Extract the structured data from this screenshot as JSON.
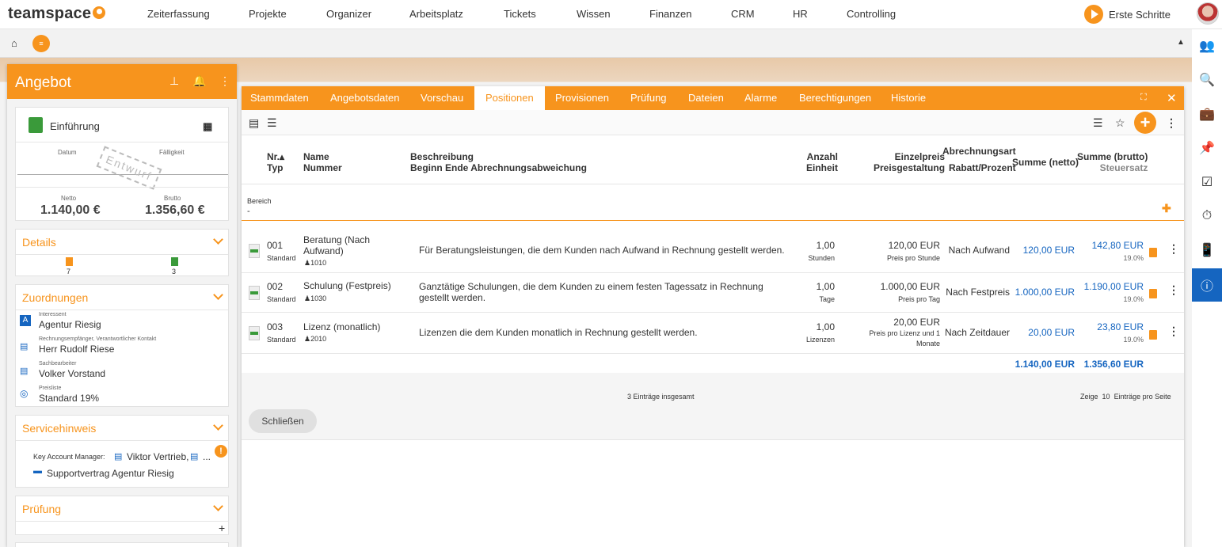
{
  "app": {
    "logo": "teamspace",
    "nav": [
      "Zeiterfassung",
      "Projekte",
      "Organizer",
      "Arbeitsplatz",
      "Tickets",
      "Wissen",
      "Finanzen",
      "CRM",
      "HR",
      "Controlling"
    ],
    "erste_schritte": "Erste Schritte"
  },
  "left": {
    "title": "Angebot",
    "einfuehrung": "Einführung",
    "datum_label": "Datum",
    "faelligkeit_label": "Fälligkeit",
    "stamp": "Entwurf",
    "netto_label": "Netto",
    "netto": "1.140,00 €",
    "brutto_label": "Brutto",
    "brutto": "1.356,60 €",
    "details": {
      "title": "Details",
      "count_a": "7",
      "count_b": "3"
    },
    "zuordnungen": {
      "title": "Zuordnungen",
      "items": [
        {
          "label": "Interessent",
          "value": "Agentur Riesig"
        },
        {
          "label": "Rechnungsempfänger, Verantwortlicher Kontakt",
          "value": "Herr Rudolf Riese"
        },
        {
          "label": "Sachbearbeiter",
          "value": "Volker Vorstand"
        },
        {
          "label": "Preisliste",
          "value": "Standard 19%"
        }
      ]
    },
    "servicehinweis": {
      "title": "Servicehinweis",
      "kam_label": "Key Account Manager:",
      "kam_value": "Viktor Vertrieb,",
      "kam_more": "...",
      "vertrag": "Supportvertrag Agentur Riesig"
    },
    "pruefung": {
      "title": "Prüfung"
    }
  },
  "dialog": {
    "tabs": [
      "Stammdaten",
      "Angebotsdaten",
      "Vorschau",
      "Positionen",
      "Provisionen",
      "Prüfung",
      "Dateien",
      "Alarme",
      "Berechtigungen",
      "Historie"
    ],
    "active_tab": "Positionen",
    "headers": {
      "nr": "Nr.▴",
      "typ": "Typ",
      "name": "Name",
      "nummer": "Nummer",
      "beschreibung": "Beschreibung",
      "beginn": "Beginn Ende Abrechnungsabweichung",
      "anzahl": "Anzahl",
      "einheit": "Einheit",
      "einzelpreis": "Einzelpreis",
      "preisgestaltung": "Preisgestaltung",
      "abrechnungsart": "Abrechnungsart",
      "rabatt": "Rabatt/Prozent",
      "summe_netto": "Summe (netto)",
      "summe_brutto": "Summe (brutto)",
      "steuersatz": "Steuersatz"
    },
    "bereich_label": "Bereich",
    "bereich_value": "-",
    "rows": [
      {
        "nr": "001",
        "typ": "Standard",
        "name": "Beratung (Nach Aufwand)",
        "nummer": "1010",
        "beschreibung": "Für Beratungsleistungen, die dem Kunden nach Aufwand in Rechnung gestellt werden.",
        "anzahl": "1,00",
        "einheit": "Stunden",
        "einzelpreis": "120,00 EUR",
        "preisgestaltung": "Preis pro Stunde",
        "abrechnungsart": "Nach Aufwand",
        "netto": "120,00 EUR",
        "brutto": "142,80 EUR",
        "steuer": "19.0%"
      },
      {
        "nr": "002",
        "typ": "Standard",
        "name": "Schulung (Festpreis)",
        "nummer": "1030",
        "beschreibung": "Ganztätige Schulungen, die dem Kunden zu einem festen Tagessatz in Rechnung gestellt werden.",
        "anzahl": "1,00",
        "einheit": "Tage",
        "einzelpreis": "1.000,00 EUR",
        "preisgestaltung": "Preis pro Tag",
        "abrechnungsart": "Nach Festpreis",
        "netto": "1.000,00 EUR",
        "brutto": "1.190,00 EUR",
        "steuer": "19.0%"
      },
      {
        "nr": "003",
        "typ": "Standard",
        "name": "Lizenz (monatlich)",
        "nummer": "2010",
        "beschreibung": "Lizenzen die dem Kunden monatlich in Rechnung gestellt werden.",
        "anzahl": "1,00",
        "einheit": "Lizenzen",
        "einzelpreis": "20,00 EUR",
        "preisgestaltung": "Preis pro Lizenz und 1 Monate",
        "abrechnungsart": "Nach Zeitdauer",
        "netto": "20,00 EUR",
        "brutto": "23,80 EUR",
        "steuer": "19.0%"
      }
    ],
    "total_netto": "1.140,00 EUR",
    "total_brutto": "1.356,60 EUR",
    "eintraege": "3 Einträge insgesamt",
    "zeige": "Zeige",
    "zeige_n": "10",
    "pro_seite": "Einträge pro Seite",
    "close_button": "Schließen"
  }
}
